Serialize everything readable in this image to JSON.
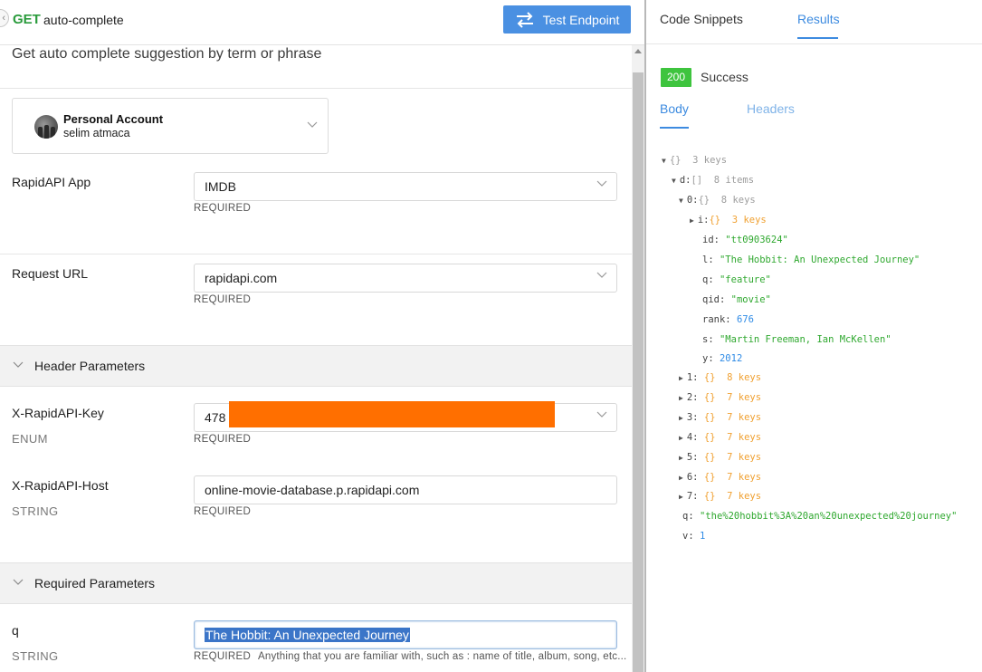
{
  "endpoint": {
    "method": "GET",
    "name": "auto-complete",
    "test_button": "Test Endpoint",
    "description": "Get auto complete suggestion by term or phrase"
  },
  "account": {
    "title": "Personal Account",
    "user": "selim atmaca"
  },
  "fields": {
    "rapidapi_app": {
      "label": "RapidAPI App",
      "value": "IMDB",
      "required": "REQUIRED"
    },
    "request_url": {
      "label": "Request URL",
      "value": "rapidapi.com",
      "required": "REQUIRED"
    }
  },
  "header_params": {
    "title": "Header Parameters",
    "key": {
      "label": "X-RapidAPI-Key",
      "type": "ENUM",
      "value": "478",
      "required": "REQUIRED"
    },
    "host": {
      "label": "X-RapidAPI-Host",
      "type": "STRING",
      "value": "online-movie-database.p.rapidapi.com",
      "required": "REQUIRED"
    }
  },
  "required_params": {
    "title": "Required Parameters",
    "q": {
      "label": "q",
      "type": "STRING",
      "value": "The Hobbit: An Unexpected Journey",
      "required": "REQUIRED",
      "hint": "Anything that you are familiar with, such as : name of title, album, song, etc..."
    }
  },
  "right_tabs": {
    "snippets": "Code Snippets",
    "results": "Results"
  },
  "response": {
    "status_code": "200",
    "status_text": "Success",
    "body_tab": "Body",
    "headers_tab": "Headers"
  },
  "json_tree": {
    "root": {
      "brace": "{}",
      "count": "3 keys"
    },
    "d": {
      "key": "d:",
      "brace": "[]",
      "count": "8 items"
    },
    "item0": {
      "key": "0:",
      "brace": "{}",
      "count": "8 keys"
    },
    "i": {
      "key": "i:",
      "brace": "{}",
      "count": "3 keys"
    },
    "id": {
      "key": "id:",
      "value": "\"tt0903624\""
    },
    "l": {
      "key": "l:",
      "value": "\"The Hobbit: An Unexpected Journey\""
    },
    "q": {
      "key": "q:",
      "value": "\"feature\""
    },
    "qid": {
      "key": "qid:",
      "value": "\"movie\""
    },
    "rank": {
      "key": "rank:",
      "value": "676"
    },
    "s": {
      "key": "s:",
      "value": "\"Martin Freeman, Ian McKellen\""
    },
    "y": {
      "key": "y:",
      "value": "2012"
    },
    "collapsed": [
      {
        "key": "1:",
        "brace": "{}",
        "count": "8 keys"
      },
      {
        "key": "2:",
        "brace": "{}",
        "count": "7 keys"
      },
      {
        "key": "3:",
        "brace": "{}",
        "count": "7 keys"
      },
      {
        "key": "4:",
        "brace": "{}",
        "count": "7 keys"
      },
      {
        "key": "5:",
        "brace": "{}",
        "count": "7 keys"
      },
      {
        "key": "6:",
        "brace": "{}",
        "count": "7 keys"
      },
      {
        "key": "7:",
        "brace": "{}",
        "count": "7 keys"
      }
    ],
    "root_q": {
      "key": "q:",
      "value": "\"the%20hobbit%3A%20an%20unexpected%20journey\""
    },
    "root_v": {
      "key": "v:",
      "value": "1"
    }
  },
  "colors": {
    "accent_blue": "#4a90e2",
    "method_green": "#2a9b3c",
    "success_badge": "#3ec43e",
    "redaction": "#ff6f00",
    "json_string": "#2fa82f",
    "json_number": "#2f8be6",
    "json_object_brace": "#f0a030"
  },
  "icons": {
    "test": "arrows-exchange-icon",
    "dropdown": "chevron-down-icon",
    "collapse": "chevron-down-icon",
    "tree_expanded": "triangle-down-icon",
    "tree_collapsed": "triangle-right-icon"
  }
}
